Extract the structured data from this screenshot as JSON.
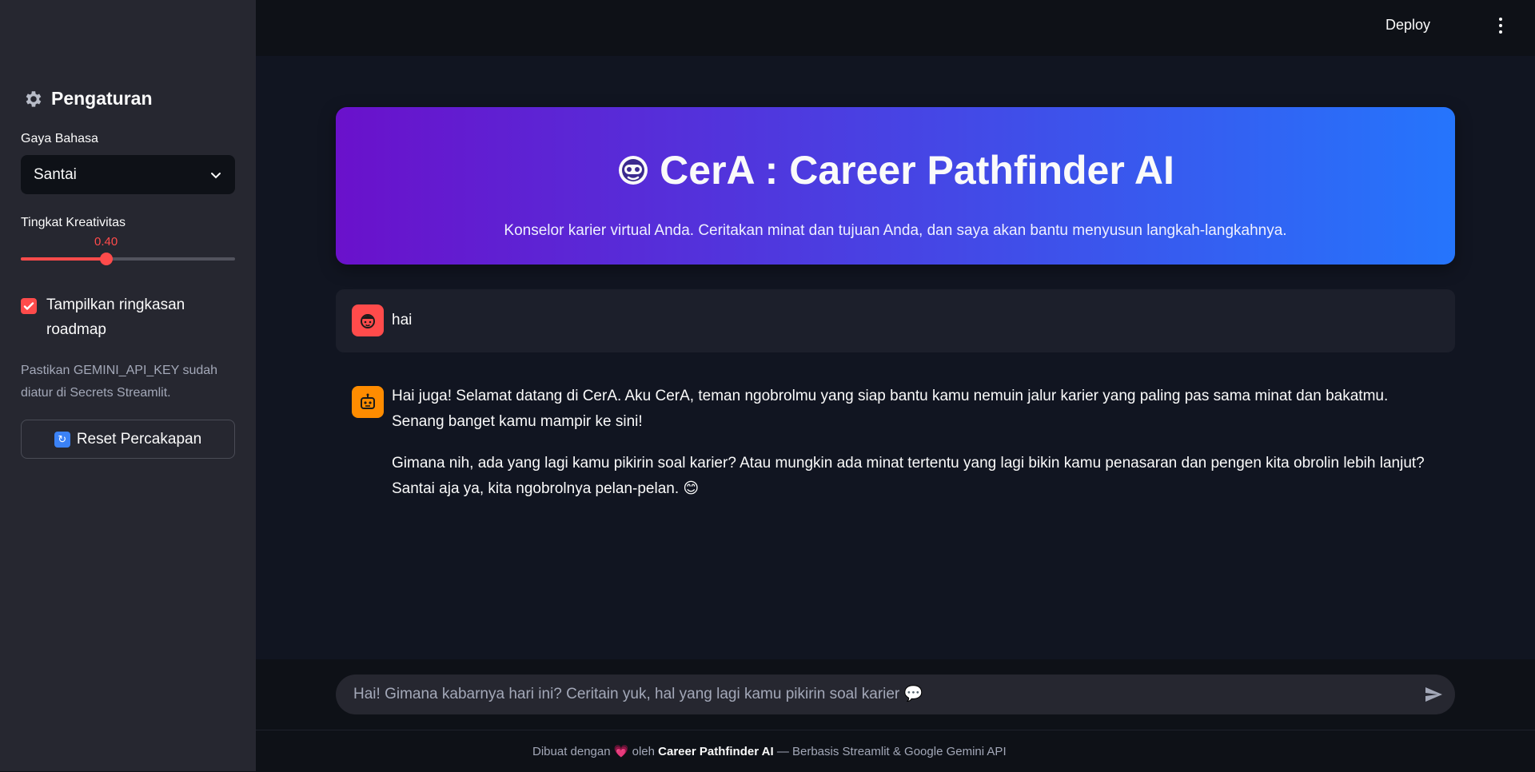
{
  "topbar": {
    "deploy_label": "Deploy",
    "menu_icon": "more-vertical-icon"
  },
  "sidebar": {
    "title": "Pengaturan",
    "title_icon": "gear-icon",
    "language_style": {
      "label": "Gaya Bahasa",
      "selected": "Santai"
    },
    "creativity": {
      "label": "Tingkat Kreativitas",
      "value": "0.40",
      "fraction": 0.4
    },
    "roadmap_checkbox": {
      "label": "Tampilkan ringkasan roadmap",
      "checked": true
    },
    "note": "Pastikan GEMINI_API_KEY sudah diatur di Secrets Streamlit.",
    "reset_button": {
      "icon": "refresh-icon",
      "label": "Reset Percakapan"
    }
  },
  "hero": {
    "icon": "robot-face-icon",
    "title": "CerA : Career Pathfinder AI",
    "subtitle": "Konselor karier virtual Anda. Ceritakan minat dan tujuan Anda, dan saya akan bantu menyusun langkah-langkahnya."
  },
  "messages": [
    {
      "role": "user",
      "avatar_icon": "user-face-icon",
      "text": "hai"
    },
    {
      "role": "assistant",
      "avatar_icon": "robot-icon",
      "paragraphs": [
        "Hai juga! Selamat datang di CerA. Aku CerA, teman ngobrolmu yang siap bantu kamu nemuin jalur karier yang paling pas sama minat dan bakatmu. Senang banget kamu mampir ke sini!",
        "Gimana nih, ada yang lagi kamu pikirin soal karier? Atau mungkin ada minat tertentu yang lagi bikin kamu penasaran dan pengen kita obrolin lebih lanjut? Santai aja ya, kita ngobrolnya pelan-pelan. 😊"
      ]
    }
  ],
  "chat_input": {
    "placeholder": "Hai! Gimana kabarnya hari ini? Ceritain yuk, hal yang lagi kamu pikirin soal karier 💬",
    "send_icon": "send-icon"
  },
  "footer": {
    "prefix": "Dibuat dengan",
    "heart": "💗",
    "by": "oleh",
    "brand": "Career Pathfinder AI",
    "suffix": "— Berbasis Streamlit & Google Gemini API"
  },
  "colors": {
    "accent": "#ff4b4b",
    "hero_start": "#6a11cb",
    "hero_end": "#2575fc",
    "sidebar_bg": "#262730",
    "main_bg": "#0e1117"
  }
}
